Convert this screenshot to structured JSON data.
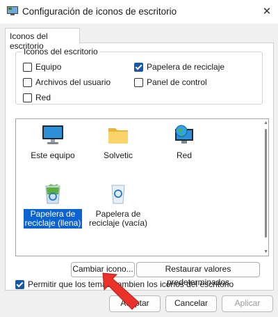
{
  "window": {
    "title": "Configuración de iconos de escritorio"
  },
  "tabs": [
    {
      "label": "Iconos del escritorio"
    }
  ],
  "group": {
    "legend": "Iconos del escritorio",
    "checkboxes": [
      {
        "label": "Equipo",
        "checked": false
      },
      {
        "label": "Papelera de reciclaje",
        "checked": true
      },
      {
        "label": "Archivos del usuario",
        "checked": false
      },
      {
        "label": "Panel de control",
        "checked": false
      },
      {
        "label": "Red",
        "checked": false
      }
    ]
  },
  "icons": [
    {
      "label": "Este equipo",
      "icon": "monitor-icon"
    },
    {
      "label": "Solvetic",
      "icon": "folder-icon"
    },
    {
      "label": "Red",
      "icon": "network-globe-icon"
    },
    {
      "label_line1": "Papelera de",
      "label_line2": "reciclaje (llena)",
      "icon": "recycle-bin-full-icon",
      "selected": true
    },
    {
      "label_line1": "Papelera de",
      "label_line2": "reciclaje (vacía)",
      "icon": "recycle-bin-empty-icon"
    }
  ],
  "buttons": {
    "change_icon": "Cambiar icono...",
    "restore_defaults": "Restaurar valores predeterminados",
    "accept": "Aceptar",
    "cancel": "Cancelar",
    "apply": "Aplicar"
  },
  "themes_checkbox": {
    "label": "Permitir que los temas cambien los iconos del escritorio",
    "checked": true
  },
  "colors": {
    "accent": "#0a63d0",
    "arrow": "#e8322a"
  }
}
